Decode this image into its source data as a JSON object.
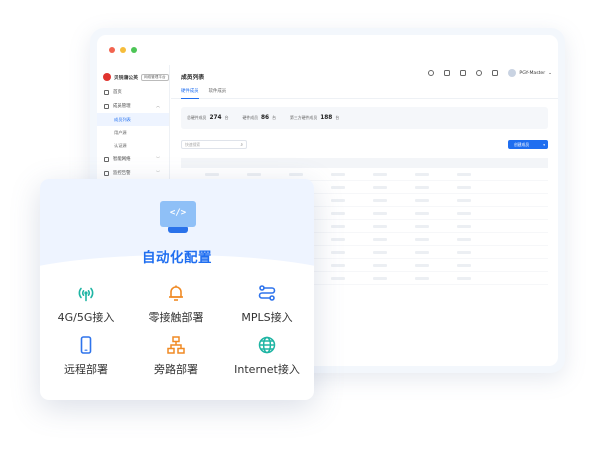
{
  "window": {
    "logo_text": "贝锐蒲公英",
    "logo_tag": "网络管理平台",
    "nav": [
      {
        "label": "首页"
      },
      {
        "label": "成员管理",
        "expanded": true
      },
      {
        "label": "成员列表",
        "sub": true,
        "active": true
      },
      {
        "label": "用户源",
        "sub": true
      },
      {
        "label": "认证源",
        "sub": true
      },
      {
        "label": "智能网络"
      },
      {
        "label": "监控告警"
      }
    ],
    "page_title": "成员列表",
    "user_name": "PGY-Master",
    "tabs": [
      {
        "label": "硬件成员",
        "active": true
      },
      {
        "label": "软件成员",
        "active": false
      }
    ],
    "stats": [
      {
        "label": "总硬件成员",
        "value": "274",
        "unit": "台"
      },
      {
        "label": "硬件成员",
        "value": "86",
        "unit": "台"
      },
      {
        "label": "第三方硬件成员",
        "value": "188",
        "unit": "台"
      }
    ],
    "search_placeholder": "快速搜索",
    "create_button": "创建成员"
  },
  "card": {
    "title": "自动化配置",
    "screen_glyph": "</>",
    "features": [
      {
        "label": "4G/5G接入",
        "icon": "signal-tower-icon",
        "color": "#1fb5a4"
      },
      {
        "label": "零接触部署",
        "icon": "robot-icon",
        "color": "#f08a24"
      },
      {
        "label": "MPLS接入",
        "icon": "network-link-icon",
        "color": "#2f74ec"
      },
      {
        "label": "远程部署",
        "icon": "mobile-phone-icon",
        "color": "#2f74ec"
      },
      {
        "label": "旁路部署",
        "icon": "topology-icon",
        "color": "#f08a24"
      },
      {
        "label": "Internet接入",
        "icon": "globe-icon",
        "color": "#1fb5a4"
      }
    ]
  }
}
